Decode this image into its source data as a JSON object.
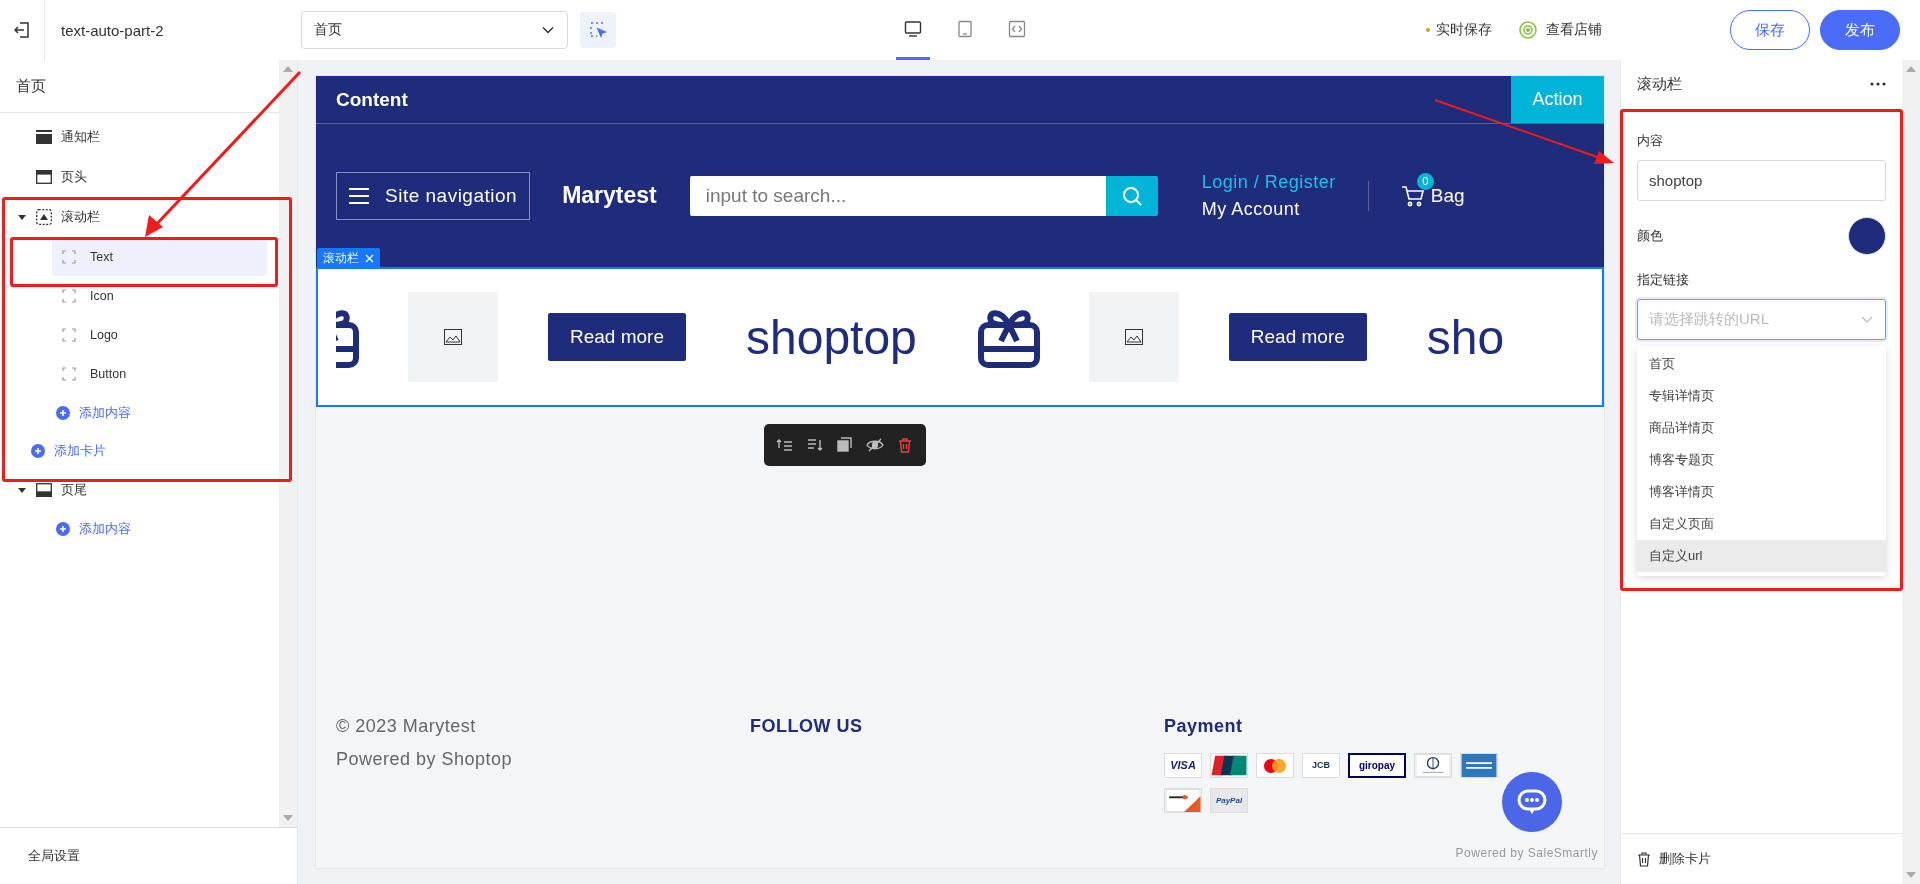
{
  "top_bar": {
    "title": "text-auto-part-2",
    "page_select": {
      "value": "首页"
    },
    "devices": [
      {
        "kind": "desktop",
        "selected": true
      },
      {
        "kind": "tablet",
        "selected": false
      },
      {
        "kind": "code",
        "selected": false
      }
    ],
    "autosave": "实时保存",
    "view_store": "查看店铺",
    "buttons": [
      {
        "label": "保存",
        "kind": "outline"
      },
      {
        "label": "发布",
        "kind": "primary"
      }
    ]
  },
  "sidebar": {
    "title": "首页",
    "items": [
      {
        "label": "通知栏",
        "kind": "notice"
      },
      {
        "label": "页头",
        "kind": "header"
      },
      {
        "label": "滚动栏",
        "kind": "marquee",
        "expanded": true,
        "children": [
          {
            "label": "Text",
            "selected": true
          },
          {
            "label": "Icon",
            "selected": false
          },
          {
            "label": "Logo",
            "selected": false
          },
          {
            "label": "Button",
            "selected": false
          }
        ],
        "add_content": "添加内容",
        "add_card": "添加卡片"
      },
      {
        "label": "页尾",
        "kind": "footer",
        "expanded": true,
        "add_content": "添加内容"
      }
    ],
    "global_settings": "全局设置"
  },
  "canvas": {
    "announcement": {
      "text": "Content",
      "action": "Action"
    },
    "header": {
      "nav_label": "Site navigation",
      "logo": "Marytest",
      "search_placeholder": "input to search...",
      "login": "Login / Register",
      "account": "My Account",
      "bag_count": "0",
      "bag": "Bag"
    },
    "selection_tag": "滚动栏",
    "marquee": [
      {
        "kind": "icon"
      },
      {
        "kind": "image"
      },
      {
        "kind": "button",
        "label": "Read more"
      },
      {
        "kind": "text",
        "text": "shoptop"
      },
      {
        "kind": "icon"
      },
      {
        "kind": "image"
      },
      {
        "kind": "button",
        "label": "Read more"
      },
      {
        "kind": "text",
        "text": "sho"
      }
    ],
    "toolbar": [
      {
        "kind": "up"
      },
      {
        "kind": "down"
      },
      {
        "kind": "copy"
      },
      {
        "kind": "hide"
      },
      {
        "kind": "delete"
      }
    ],
    "footer": {
      "copyright": "© 2023 Marytest",
      "powered": "Powered by Shoptop",
      "follow_heading": "FOLLOW US",
      "payment_heading": "Payment",
      "payment_methods": [
        {
          "kind": "visa",
          "label": "VISA"
        },
        {
          "kind": "unionpay"
        },
        {
          "kind": "mastercard"
        },
        {
          "kind": "jcb",
          "label": "JCB"
        },
        {
          "kind": "giropay",
          "label": "giropay"
        },
        {
          "kind": "diners"
        },
        {
          "kind": "amex"
        },
        {
          "kind": "discover"
        },
        {
          "kind": "paypal",
          "label": "PayPal"
        }
      ],
      "chat_credit": "Powered by SaleSmartly"
    }
  },
  "panel": {
    "title": "滚动栏",
    "content_label": "内容",
    "content_value": "shoptop",
    "color_label": "颜色",
    "color": "#1f2b7b",
    "link_label": "指定链接",
    "link_placeholder": "请选择跳转的URL",
    "options": [
      {
        "label": "首页",
        "highlighted": false
      },
      {
        "label": "专辑详情页",
        "highlighted": false
      },
      {
        "label": "商品详情页",
        "highlighted": false
      },
      {
        "label": "博客专题页",
        "highlighted": false
      },
      {
        "label": "博客详情页",
        "highlighted": false
      },
      {
        "label": "自定义页面",
        "highlighted": false
      },
      {
        "label": "自定义url",
        "highlighted": true
      }
    ],
    "delete_card": "删除卡片"
  }
}
